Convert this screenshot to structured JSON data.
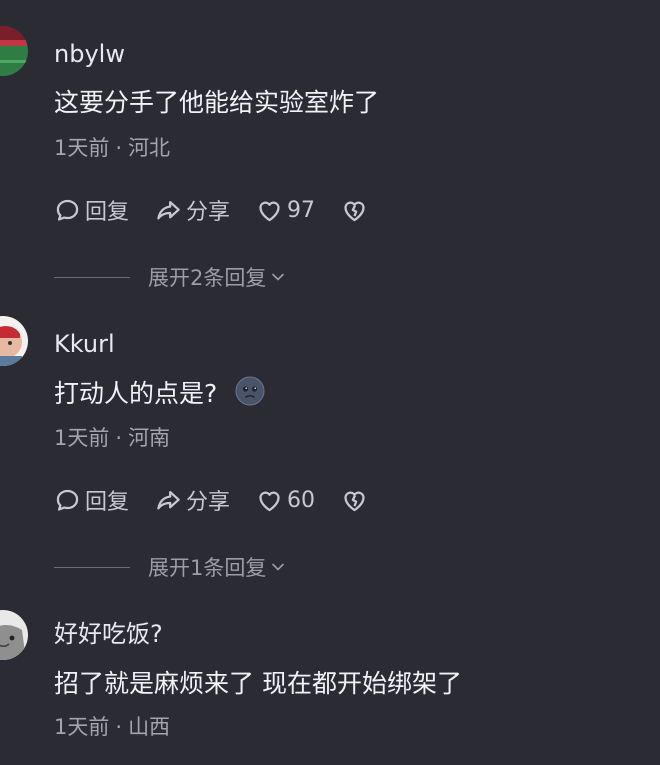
{
  "comments": [
    {
      "username": "nbylw",
      "text": "这要分手了他能给实验室炸了",
      "time": "1天前",
      "separator": "·",
      "location": "河北",
      "reply_label": "回复",
      "share_label": "分享",
      "like_count": "97",
      "expand_label": "展开2条回复"
    },
    {
      "username": "Kkurl",
      "text": "打动人的点是?",
      "time": "1天前",
      "separator": "·",
      "location": "河南",
      "reply_label": "回复",
      "share_label": "分享",
      "like_count": "60",
      "expand_label": "展开1条回复"
    },
    {
      "username": "好好吃饭?",
      "text": "招了就是麻烦来了 现在都开始绑架了",
      "time": "1天前",
      "separator": "·",
      "location": "山西"
    }
  ],
  "icons": {
    "reply": "comment-bubble-icon",
    "share": "share-arrow-icon",
    "like": "heart-icon",
    "dislike": "broken-heart-icon",
    "expand": "chevron-down-icon",
    "emoji": "cold-face-emoji-icon"
  },
  "colors": {
    "background": "#2a2b33",
    "text": "#f2f2f6",
    "meta": "#a3a4ad",
    "icon": "#c7c8d0"
  }
}
